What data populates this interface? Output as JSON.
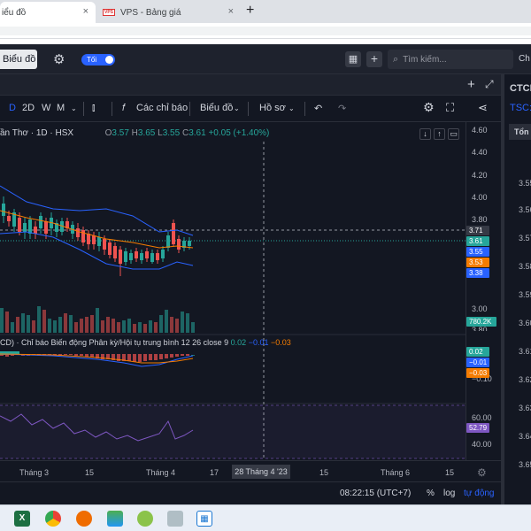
{
  "browser": {
    "tabs": [
      {
        "title": "iểu đồ",
        "active": true
      },
      {
        "title": "VPS - Bảng giá",
        "active": false
      }
    ],
    "new_tab": "+",
    "close": "×",
    "vps_logo": "VPS"
  },
  "app_header": {
    "chart_button": "Biểu đồ",
    "theme_toggle": "Tối",
    "search_placeholder": "Tìm kiếm...",
    "right_cut": "Ch"
  },
  "toolbar": {
    "items": [
      "D",
      "2D",
      "W",
      "M"
    ],
    "active": "D",
    "indicators": "Các chỉ báo",
    "chart": "Biểu đồ",
    "profile": "Hồ sơ"
  },
  "symbol": {
    "name": "ần Thơ · 1D · HSX",
    "o_label": "O",
    "o": "3.57",
    "h_label": "H",
    "h": "3.65",
    "l_label": "L",
    "l": "3.55",
    "c_label": "C",
    "c": "3.61",
    "change": "+0.05 (+1.40%)"
  },
  "macd_legend": {
    "title": "CD) · Chỉ báo Biến động Phân kỳ/Hội tụ trung bình 12 26 close 9",
    "v1": "0.02",
    "v2": "−0.01",
    "v3": "−0.03"
  },
  "price_axis": {
    "ticks": [
      "4.60",
      "4.40",
      "4.20",
      "4.00",
      "3.80",
      "3.00",
      "3.80",
      "−0.10",
      "60.00",
      "40.00"
    ],
    "badges": [
      {
        "label": "3.71",
        "color": "#363a45"
      },
      {
        "label": "3.61",
        "color": "#26a69a"
      },
      {
        "label": "3.55",
        "color": "#2962ff"
      },
      {
        "label": "3.53",
        "color": "#f57c00"
      },
      {
        "label": "3.38",
        "color": "#2962ff"
      },
      {
        "label": "780.2K",
        "color": "#26a69a"
      },
      {
        "label": "0.02",
        "color": "#26a69a"
      },
      {
        "label": "−0.01",
        "color": "#2962ff"
      },
      {
        "label": "−0.03",
        "color": "#f57c00"
      },
      {
        "label": "52.79",
        "color": "#7e57c2"
      }
    ]
  },
  "time_axis": {
    "labels": [
      "Tháng 3",
      "15",
      "Tháng 4",
      "17",
      "15",
      "Tháng 6",
      "15"
    ],
    "cursor": "28 Tháng 4 '23"
  },
  "status": {
    "time": "08:22:15 (UTC+7)",
    "percent": "%",
    "log": "log",
    "auto": "tự động"
  },
  "side_panel": {
    "title": "CTCI",
    "code": "TSC:",
    "tab": "Tổn",
    "prices": [
      "3.55",
      "3.56",
      "3.57",
      "3.58",
      "3.59",
      "3.60",
      "3.61",
      "3.62",
      "3.63",
      "3.64",
      "3.65"
    ]
  },
  "colors": {
    "up": "#26a69a",
    "down": "#ef5350",
    "accent": "#2962ff",
    "bollinger": "#2962ff",
    "ma": "#f57c00",
    "rsi": "#7e57c2"
  }
}
